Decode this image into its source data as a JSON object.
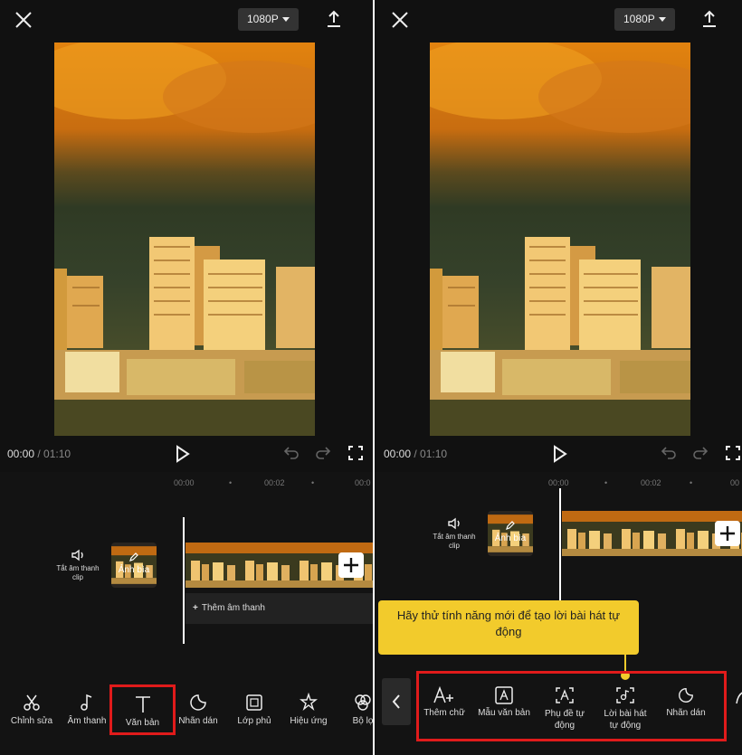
{
  "colors": {
    "accent_red": "#e01b1b",
    "tooltip_yellow": "#f2cb2c"
  },
  "left": {
    "resolution": "1080P",
    "time_current": "00:00",
    "time_sep": " / ",
    "time_total": "01:10",
    "ruler": [
      "00:00",
      "•",
      "00:02",
      "•",
      "00:0"
    ],
    "mute_label": "Tắt âm thanh clip",
    "cover_label": "Ảnh bìa",
    "add_audio_label": "Thêm âm thanh",
    "tools": [
      {
        "label": "Chỉnh sửa",
        "icon": "scissors-icon"
      },
      {
        "label": "Âm thanh",
        "icon": "music-note-icon"
      },
      {
        "label": "Văn bản",
        "icon": "text-icon"
      },
      {
        "label": "Nhãn dán",
        "icon": "sticker-icon"
      },
      {
        "label": "Lớp phủ",
        "icon": "overlay-icon"
      },
      {
        "label": "Hiệu ứng",
        "icon": "effects-icon"
      },
      {
        "label": "Bộ lọ",
        "icon": "filter-icon"
      }
    ]
  },
  "right": {
    "resolution": "1080P",
    "time_current": "00:00",
    "time_sep": " / ",
    "time_total": "01:10",
    "ruler": [
      "00:00",
      "•",
      "00:02",
      "•",
      "00"
    ],
    "mute_label": "Tắt âm thanh clip",
    "cover_label": "Ảnh bìa",
    "tooltip": "Hãy thử tính năng mới để tạo lời bài hát tự động",
    "tools": [
      {
        "label": "Thêm chữ",
        "icon": "add-text-icon"
      },
      {
        "label": "Mẫu văn bản",
        "icon": "text-template-icon"
      },
      {
        "label": "Phụ đề tự động",
        "icon": "auto-caption-icon"
      },
      {
        "label": "Lời bài hát tự động",
        "icon": "auto-lyrics-icon"
      },
      {
        "label": "Nhãn dán",
        "icon": "sticker-icon"
      }
    ]
  }
}
